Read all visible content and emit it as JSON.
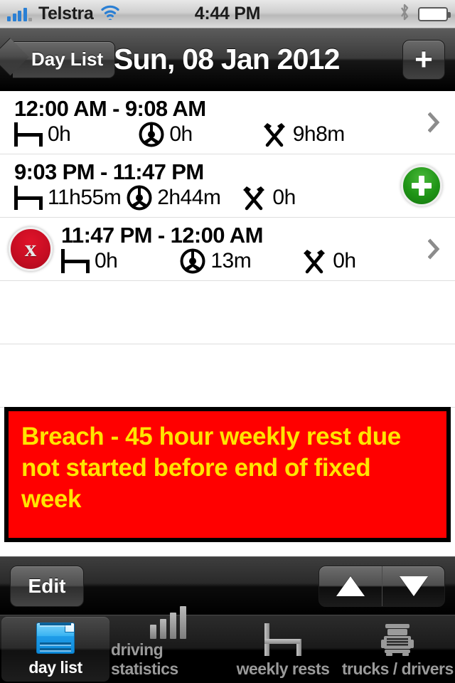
{
  "status_bar": {
    "carrier": "Telstra",
    "time": "4:44 PM",
    "signal_icon": "signal-bars-icon",
    "wifi_icon": "wifi-icon",
    "bluetooth_icon": "bluetooth-icon",
    "battery_icon": "battery-full-icon"
  },
  "nav_bar": {
    "back_label": "Day List",
    "title": "Sun, 08 Jan 2012",
    "add_label": "+"
  },
  "rows": [
    {
      "time_range": "12:00 AM - 9:08 AM",
      "rest": "0h",
      "driving": "0h",
      "work": "9h8m",
      "accessory": "chevron",
      "has_delete": false
    },
    {
      "time_range": "9:03 PM - 11:47 PM",
      "rest": "11h55m",
      "driving": "2h44m",
      "work": "0h",
      "accessory": "insert",
      "has_delete": false
    },
    {
      "time_range": "11:47 PM - 12:00 AM",
      "rest": "0h",
      "driving": "13m",
      "work": "0h",
      "accessory": "chevron",
      "has_delete": true,
      "delete_label": "x"
    }
  ],
  "icons": {
    "rest": "bed-icon",
    "driving": "steering-wheel-icon",
    "work": "crossed-hammers-icon"
  },
  "breach": {
    "message": "Breach - 45 hour weekly rest due not started before end of fixed week",
    "background_color": "#ff0000",
    "text_color": "#ffe400"
  },
  "toolbar": {
    "edit_label": "Edit",
    "up_icon": "triangle-up-icon",
    "down_icon": "triangle-down-icon"
  },
  "tab_bar": {
    "tabs": [
      {
        "label": "day list",
        "icon": "day-list-icon",
        "selected": true
      },
      {
        "label": "driving statistics",
        "icon": "bar-chart-icon",
        "selected": false
      },
      {
        "label": "weekly rests",
        "icon": "bed-icon",
        "selected": false
      },
      {
        "label": "trucks / drivers",
        "icon": "truck-icon",
        "selected": false
      }
    ]
  }
}
